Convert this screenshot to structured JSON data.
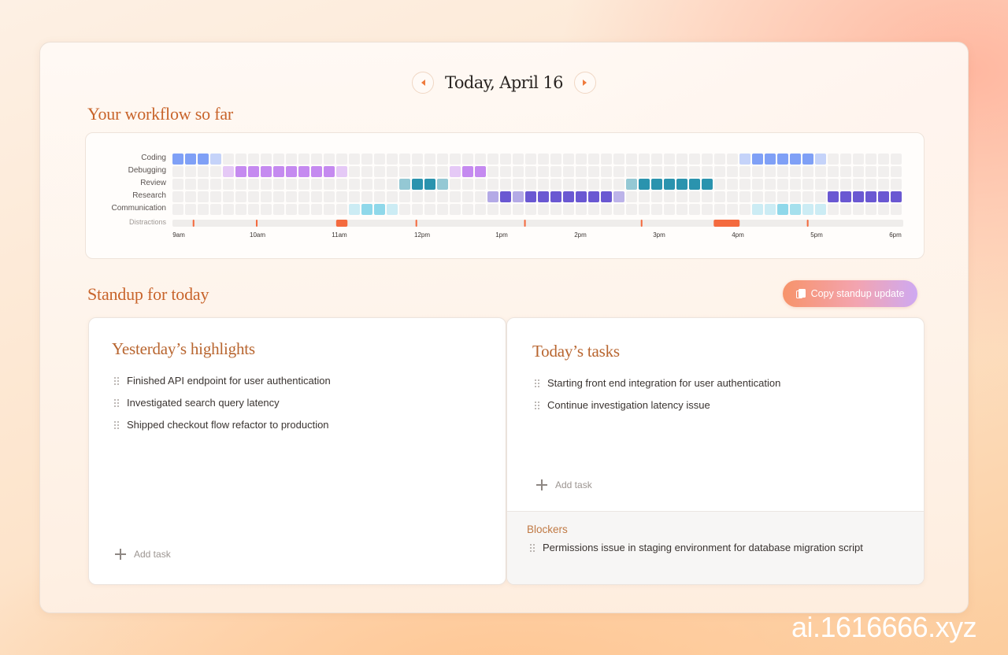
{
  "date_nav": {
    "title": "Today, April 16",
    "prev_icon": "chevron-left-icon",
    "next_icon": "chevron-right-icon"
  },
  "workflow": {
    "title": "Your workflow so far",
    "rows": [
      "Coding",
      "Debugging",
      "Review",
      "Research",
      "Communication"
    ],
    "distractions_label": "Distractions",
    "time_labels": [
      "9am",
      "10am",
      "11am",
      "12pm",
      "1pm",
      "2pm",
      "3pm",
      "4pm",
      "5pm",
      "6pm"
    ],
    "colors": {
      "Coding": "#7fa0f6",
      "Debugging": "#c58af0",
      "Review": "#2a93ae",
      "Research": "#6a58d2",
      "Communication": "#8fd8ea",
      "empty": "#f1efee",
      "distraction": "#f46a3e",
      "distraction_track": "#efedeb"
    },
    "blocks": {
      "Coding": [
        [
          0,
          1.0
        ],
        [
          1,
          1.0
        ],
        [
          2,
          1.0
        ],
        [
          3,
          0.45
        ],
        [
          45,
          0.45
        ],
        [
          46,
          1.0
        ],
        [
          47,
          1.0
        ],
        [
          48,
          1.0
        ],
        [
          49,
          1.0
        ],
        [
          50,
          1.0
        ],
        [
          51,
          0.45
        ]
      ],
      "Debugging": [
        [
          4,
          0.45
        ],
        [
          5,
          1.0
        ],
        [
          6,
          1.0
        ],
        [
          7,
          1.0
        ],
        [
          8,
          1.0
        ],
        [
          9,
          1.0
        ],
        [
          10,
          1.0
        ],
        [
          11,
          1.0
        ],
        [
          12,
          1.0
        ],
        [
          13,
          0.45
        ],
        [
          22,
          0.45
        ],
        [
          23,
          1.0
        ],
        [
          24,
          1.0
        ]
      ],
      "Review": [
        [
          18,
          0.5
        ],
        [
          19,
          1.0
        ],
        [
          20,
          1.0
        ],
        [
          21,
          0.5
        ],
        [
          36,
          0.5
        ],
        [
          37,
          1.0
        ],
        [
          38,
          1.0
        ],
        [
          39,
          1.0
        ],
        [
          40,
          1.0
        ],
        [
          41,
          1.0
        ],
        [
          42,
          1.0
        ]
      ],
      "Research": [
        [
          25,
          0.5
        ],
        [
          26,
          1.0
        ],
        [
          27,
          0.5
        ],
        [
          28,
          1.0
        ],
        [
          29,
          1.0
        ],
        [
          30,
          1.0
        ],
        [
          31,
          1.0
        ],
        [
          32,
          1.0
        ],
        [
          33,
          1.0
        ],
        [
          34,
          1.0
        ],
        [
          35,
          0.45
        ],
        [
          52,
          1.0
        ],
        [
          53,
          1.0
        ],
        [
          54,
          1.0
        ],
        [
          55,
          1.0
        ],
        [
          56,
          1.0
        ],
        [
          57,
          1.0
        ]
      ],
      "Communication": [
        [
          14,
          0.45
        ],
        [
          15,
          1.0
        ],
        [
          16,
          1.0
        ],
        [
          17,
          0.45
        ],
        [
          46,
          0.45
        ],
        [
          47,
          0.45
        ],
        [
          48,
          1.0
        ],
        [
          49,
          0.8
        ],
        [
          50,
          0.45
        ],
        [
          51,
          0.45
        ]
      ]
    },
    "distractions": [
      {
        "start_h": 0.25,
        "end_h": 0.27
      },
      {
        "start_h": 1.03,
        "end_h": 1.05
      },
      {
        "start_h": 2.02,
        "end_h": 2.16
      },
      {
        "start_h": 3.0,
        "end_h": 3.02
      },
      {
        "start_h": 4.34,
        "end_h": 4.36
      },
      {
        "start_h": 5.78,
        "end_h": 5.8
      },
      {
        "start_h": 6.68,
        "end_h": 7.0
      },
      {
        "start_h": 7.83,
        "end_h": 7.85
      }
    ]
  },
  "standup": {
    "title": "Standup for today",
    "copy_button": "Copy standup update",
    "copy_icon": "copy-icon"
  },
  "yesterday": {
    "title": "Yesterday’s highlights",
    "items": [
      "Finished API endpoint for user authentication",
      "Investigated search query latency",
      "Shipped checkout flow refactor to production"
    ],
    "add_label": "Add task"
  },
  "today": {
    "title": "Today’s tasks",
    "items": [
      "Starting front end integration for user authentication",
      "Continue investigation latency issue"
    ],
    "add_label": "Add task"
  },
  "blockers": {
    "title": "Blockers",
    "items": [
      "Permissions issue in staging environment for database migration script"
    ]
  },
  "watermark": "ai.1616666.xyz"
}
